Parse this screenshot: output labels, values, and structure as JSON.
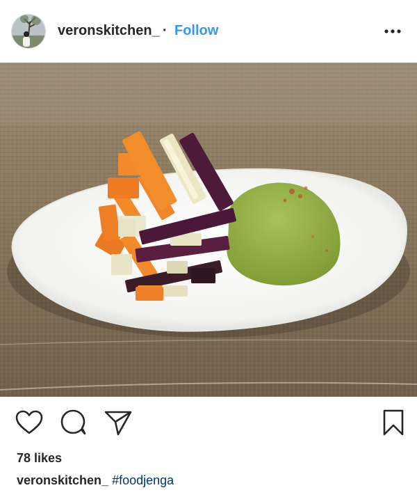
{
  "post": {
    "username": "veronskitchen_",
    "separator": "·",
    "follow_label": "Follow",
    "likes_text": "78 likes",
    "caption_user": "veronskitchen_",
    "caption_hashtag": "#foodjenga"
  },
  "icons": {
    "more": "more-options-icon",
    "like": "heart-icon",
    "comment": "comment-bubble-icon",
    "share": "paper-plane-icon",
    "save": "bookmark-icon"
  },
  "colors": {
    "link_blue": "#3897f0",
    "hashtag": "#003569",
    "text": "#262626"
  }
}
